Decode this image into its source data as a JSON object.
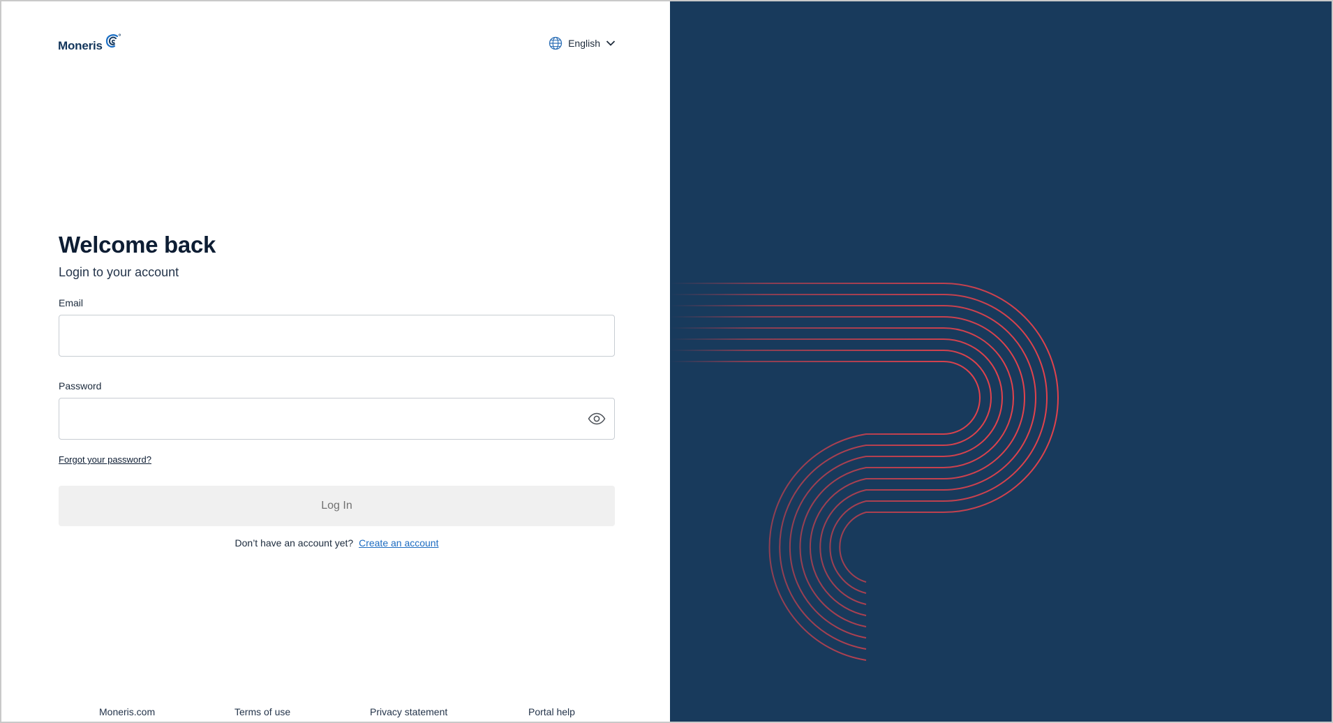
{
  "brand": {
    "name": "Moneris",
    "logo_icon": "moneris-swirl-icon"
  },
  "language": {
    "icon": "globe-icon",
    "selected": "English",
    "chevron": "chevron-down-icon"
  },
  "form": {
    "title": "Welcome back",
    "subtitle": "Login to your account",
    "email_label": "Email",
    "email_value": "",
    "password_label": "Password",
    "password_value": "",
    "password_toggle_icon": "eye-icon",
    "forgot_link": "Forgot your password?",
    "login_button": "Log In",
    "signup_prompt": "Don’t have an account yet?",
    "signup_link": "Create an account"
  },
  "footer": {
    "links": [
      "Moneris.com",
      "Terms of use",
      "Privacy statement",
      "Portal help"
    ]
  },
  "colors": {
    "panel_bg": "#183a5c",
    "stripe_red": "#e2424c",
    "stripe_blue": "#4aa3e0",
    "link_blue": "#1d6cc1",
    "button_disabled_bg": "#f0f0f0"
  }
}
